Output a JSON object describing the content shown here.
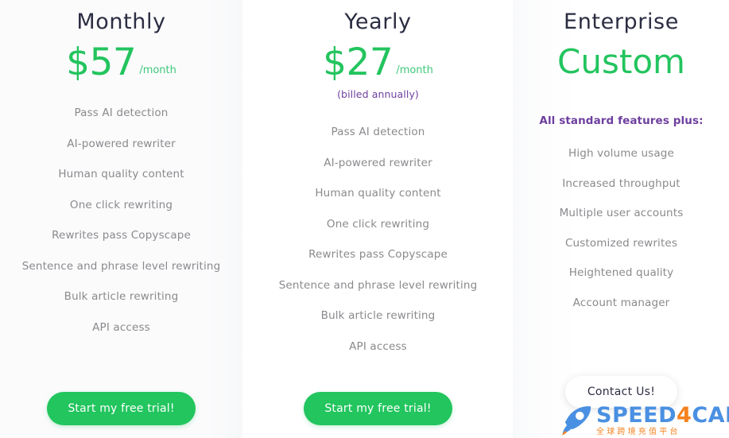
{
  "colors": {
    "green": "#22c55e",
    "green_price": "#23c45e",
    "green_period": "#3ec97a",
    "purple": "#6e3f9e",
    "title_navy": "#2b2d42",
    "feature_gray": "#8a8a8e",
    "logo_blue": "#4a90e2",
    "logo_orange": "#f58220"
  },
  "plans": [
    {
      "id": "monthly",
      "title": "Monthly",
      "price": "$57",
      "period": "/month",
      "billed_note": "",
      "features": [
        "Pass AI detection",
        "AI-powered rewriter",
        "Human quality content",
        "One click rewriting",
        "Rewrites pass Copyscape",
        "Sentence and phrase level rewriting",
        "Bulk article rewriting",
        "API access"
      ],
      "cta": "Start my free trial!"
    },
    {
      "id": "yearly",
      "title": "Yearly",
      "price": "$27",
      "period": "/month",
      "billed_note": "(billed annually)",
      "features": [
        "Pass AI detection",
        "AI-powered rewriter",
        "Human quality content",
        "One click rewriting",
        "Rewrites pass Copyscape",
        "Sentence and phrase level rewriting",
        "Bulk article rewriting",
        "API access"
      ],
      "cta": "Start my free trial!"
    },
    {
      "id": "enterprise",
      "title": "Enterprise",
      "price_word": "Custom",
      "features_heading": "All standard features plus:",
      "features": [
        "High volume usage",
        "Increased throughput",
        "Multiple user accounts",
        "Customized rewrites",
        "Heightened quality",
        "Account manager"
      ],
      "cta": "Contact Us!"
    }
  ],
  "watermark": {
    "brand_part1": "SPEED",
    "brand_digit": "4",
    "brand_part2": "CARD",
    "subtitle": "全球跨境充值平台"
  }
}
